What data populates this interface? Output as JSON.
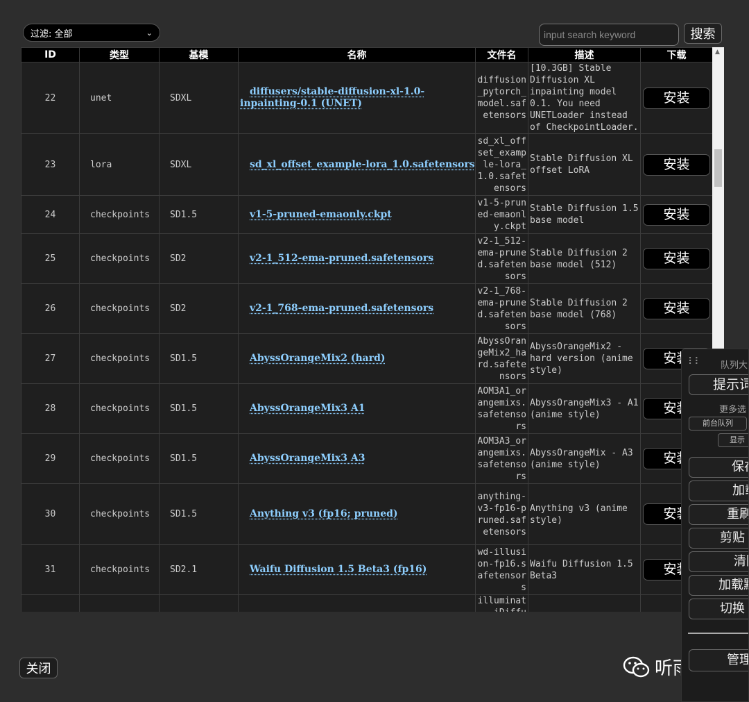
{
  "filter": {
    "label": "过滤: 全部"
  },
  "search": {
    "placeholder": "input search keyword",
    "button_label": "搜索"
  },
  "table": {
    "headers": {
      "id": "ID",
      "type": "类型",
      "base": "基模",
      "name": "名称",
      "file": "文件名",
      "desc": "描述",
      "download": "下载"
    },
    "install_label": "安装",
    "rows": [
      {
        "id": "22",
        "type": "unet",
        "base": "SDXL",
        "name": "diffusers/stable-diffusion-xl-1.0-inpainting-0.1 (UNET)",
        "file": "diffusion_pytorch_model.safetensors",
        "desc": "[10.3GB] Stable Diffusion XL inpainting model 0.1. You need UNETLoader instead of CheckpointLoader."
      },
      {
        "id": "23",
        "type": "lora",
        "base": "SDXL",
        "name": "sd_xl_offset_example-lora_1.0.safetensors",
        "file": "sd_xl_offset_example-lora_1.0.safetensors",
        "desc": "Stable Diffusion XL offset LoRA"
      },
      {
        "id": "24",
        "type": "checkpoints",
        "base": "SD1.5",
        "name": "v1-5-pruned-emaonly.ckpt",
        "file": "v1-5-pruned-emaonly.ckpt",
        "desc": "Stable Diffusion 1.5 base model"
      },
      {
        "id": "25",
        "type": "checkpoints",
        "base": "SD2",
        "name": "v2-1_512-ema-pruned.safetensors",
        "file": "v2-1_512-ema-pruned.safetensors",
        "desc": "Stable Diffusion 2 base model (512)"
      },
      {
        "id": "26",
        "type": "checkpoints",
        "base": "SD2",
        "name": "v2-1_768-ema-pruned.safetensors",
        "file": "v2-1_768-ema-pruned.safetensors",
        "desc": "Stable Diffusion 2 base model (768)"
      },
      {
        "id": "27",
        "type": "checkpoints",
        "base": "SD1.5",
        "name": "AbyssOrangeMix2 (hard)",
        "file": "AbyssOrangeMix2_hard.safetensors",
        "desc": "AbyssOrangeMix2 - hard version (anime style)"
      },
      {
        "id": "28",
        "type": "checkpoints",
        "base": "SD1.5",
        "name": "AbyssOrangeMix3 A1",
        "file": "AOM3A1_orangemixs.safetensors",
        "desc": "AbyssOrangeMix3 - A1 (anime style)"
      },
      {
        "id": "29",
        "type": "checkpoints",
        "base": "SD1.5",
        "name": "AbyssOrangeMix3 A3",
        "file": "AOM3A3_orangemixs.safetensors",
        "desc": "AbyssOrangeMix - A3 (anime style)"
      },
      {
        "id": "30",
        "type": "checkpoints",
        "base": "SD1.5",
        "name": "Anything v3 (fp16; pruned)",
        "file": "anything-v3-fp16-pruned.safetensors",
        "desc": "Anything v3 (anime style)"
      },
      {
        "id": "31",
        "type": "checkpoints",
        "base": "SD2.1",
        "name": "Waifu Diffusion 1.5 Beta3 (fp16)",
        "file": "wd-illusion-fp16.safetensors",
        "desc": "Waifu Diffusion 1.5 Beta3"
      },
      {
        "id": "",
        "type": "",
        "base": "",
        "name": "",
        "file": "illuminatiDiffu",
        "desc": ""
      }
    ]
  },
  "close_label": "关闭",
  "watermark": {
    "text": "听雨AGI"
  },
  "queue_panel": {
    "title": "队列大",
    "prompt_btn": "提示词",
    "more_options": "更多选",
    "front_queue": "前台队列",
    "show": "显示",
    "buttons": [
      "保存",
      "加载",
      "重刷",
      "剪贴",
      "清除",
      "加载默",
      "切换"
    ],
    "manage": "管理"
  }
}
